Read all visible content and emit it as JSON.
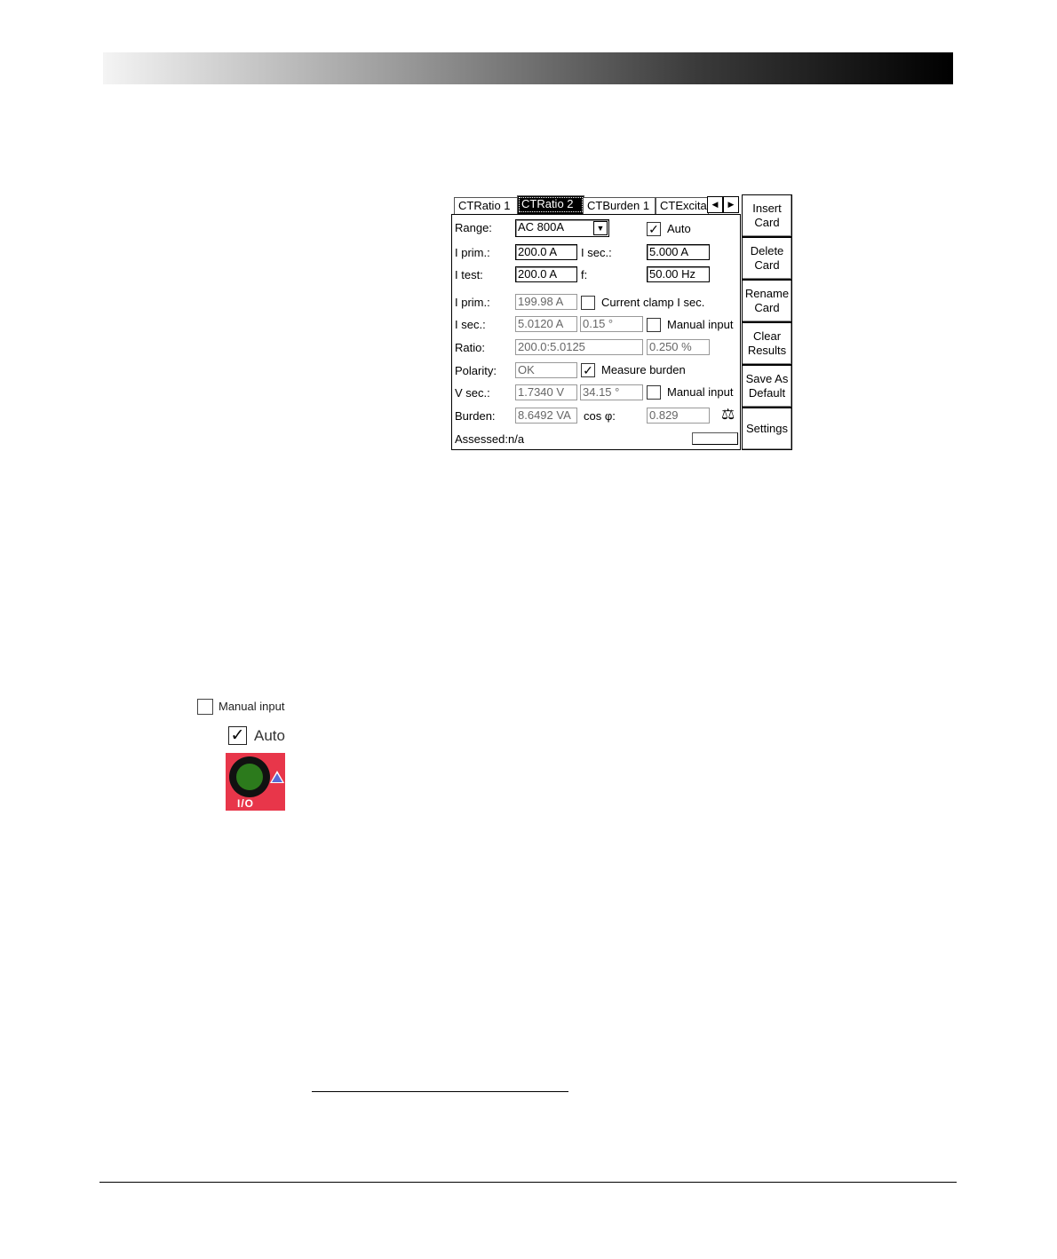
{
  "tabs": [
    "CTRatio 1",
    "CTRatio 2",
    "CTBurden 1",
    "CTExcita"
  ],
  "active_tab": "CTRatio 2",
  "tab_arrows": {
    "left": "◀",
    "right": "▶"
  },
  "form": {
    "range_label": "Range:",
    "range_value": "AC 800A",
    "auto_label": "Auto",
    "iprim_label": "I prim.:",
    "iprim_value": "200.0 A",
    "isec_label": "I sec.:",
    "isec_value": "5.000 A",
    "itest_label": "I test:",
    "itest_value": "200.0 A",
    "f_label": "f:",
    "f_value": "50.00 Hz",
    "iprim_meas_label": "I prim.:",
    "iprim_meas_value": "199.98 A",
    "current_clamp_label": "Current clamp I sec.",
    "isec_meas_label": "I sec.:",
    "isec_meas_value": "5.0120 A",
    "isec_phase_value": "0.15 °",
    "manual_input_label": "Manual input",
    "ratio_label": "Ratio:",
    "ratio_value": "200.0:5.0125",
    "ratio_dev_value": "0.250 %",
    "polarity_label": "Polarity:",
    "polarity_value": "OK",
    "measure_burden_label": "Measure burden",
    "vsec_label": "V sec.:",
    "vsec_value": "1.7340 V",
    "vsec_phase_value": "34.15 °",
    "manual_input2_label": "Manual input",
    "burden_label": "Burden:",
    "burden_value": "8.6492 VA",
    "cosphi_label": "cos φ:",
    "cosphi_value": "0.829",
    "assessed_text": "Assessed:n/a"
  },
  "side_buttons": [
    {
      "l1": "Insert",
      "l2": "Card"
    },
    {
      "l1": "Delete",
      "l2": "Card"
    },
    {
      "l1": "Rename",
      "l2": "Card"
    },
    {
      "l1": "Clear",
      "l2": "Results"
    },
    {
      "l1": "Save As",
      "l2": "Default"
    },
    {
      "l1": "Settings",
      "l2": ""
    }
  ],
  "legend": {
    "manual_input_label": "Manual input",
    "auto_label": "Auto",
    "io_label": "I/O"
  },
  "icons": {
    "checkmark": "✓",
    "dropdown": "▼",
    "scale": "⚖"
  },
  "colors": {
    "io_button": "#e8364a",
    "io_core": "#2c7a1c",
    "warn": "#5a6bd6"
  }
}
